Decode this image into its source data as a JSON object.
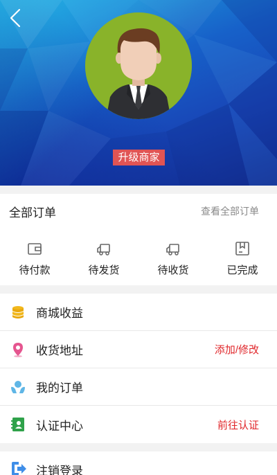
{
  "header": {
    "back_icon": "chevron-left-icon",
    "upgrade_label": "升级商家",
    "upgrade_color": "#e05454"
  },
  "orders": {
    "title": "全部订单",
    "view_all": "查看全部订单",
    "tabs": [
      {
        "label": "待付款",
        "icon": "wallet-icon"
      },
      {
        "label": "待发货",
        "icon": "truck-icon"
      },
      {
        "label": "待收货",
        "icon": "truck-icon"
      },
      {
        "label": "已完成",
        "icon": "box-check-icon"
      }
    ]
  },
  "menu": {
    "items": [
      {
        "label": "商城收益",
        "icon": "coins-icon",
        "right": ""
      },
      {
        "label": "收货地址",
        "icon": "location-pin-icon",
        "right": "添加/修改"
      },
      {
        "label": "我的订单",
        "icon": "hands-icon",
        "right": ""
      },
      {
        "label": "认证中心",
        "icon": "id-card-icon",
        "right": "前往认证"
      }
    ],
    "logout": {
      "label": "注销登录",
      "icon": "logout-icon"
    }
  },
  "colors": {
    "accent_red": "#e0262a",
    "header_blue": "#1761c9",
    "avatar_bg": "#89b32a"
  }
}
